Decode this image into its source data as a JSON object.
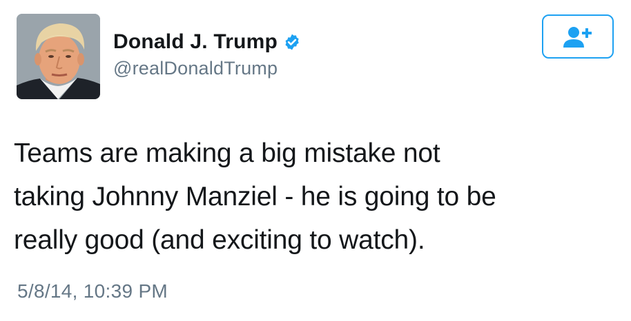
{
  "author": {
    "display_name": "Donald J. Trump",
    "handle": "@realDonaldTrump",
    "verified": true,
    "avatar_icon": "profile-photo"
  },
  "follow_button": {
    "icon": "add-user-icon",
    "color": "#1da1f2"
  },
  "tweet": {
    "text_lines": [
      "Teams are making a big mistake not",
      "taking Johnny Manziel - he is going to be",
      "really good (and exciting to watch)."
    ],
    "timestamp": "5/8/14, 10:39 PM"
  },
  "colors": {
    "text": "#14171a",
    "secondary_text": "#657786",
    "accent": "#1da1f2"
  }
}
